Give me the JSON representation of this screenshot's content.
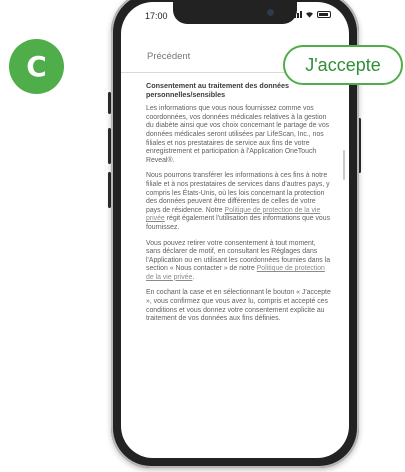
{
  "badge": {
    "letter": "C",
    "color": "#4fae4a"
  },
  "status": {
    "time": "17:00"
  },
  "nav": {
    "back_label": "Précédent",
    "accept_label": "J'accepte"
  },
  "content": {
    "title": "Consentement au traitement des données personnelles/sensibles",
    "p1": "Les informations que vous nous fournissez comme vos coordonnées, vos données médicales relatives à la gestion du diabète ainsi que vos choix concernant le partage de vos données médicales seront utilisées par LifeScan, Inc., nos filiales et nos prestataires de service aux fins de votre enregistrement et participation à l'Application OneTouch Reveal®.",
    "p2_before": "Nous pourrons transférer les informations à ces fins à notre filiale et à nos prestataires de services dans d'autres pays, y compris les États-Unis, où les lois concernant la protection des données peuvent être différentes de celles de votre pays de résidence. Notre ",
    "p2_link": "Politique de protection de la vie privée",
    "p2_after": " régit également l'utilisation des informations que vous fournissez.",
    "p3_before": "Vous pouvez retirer votre consentement à tout moment, sans déclarer de motif, en consultant les Réglages dans l'Application ou en utilisant les coordonnées fournies dans la section « Nous contacter » de notre ",
    "p3_link": "Politique de protection de la vie privée",
    "p3_after": ".",
    "p4": "En cochant la case et en sélectionnant le bouton « J'accepte », vous confirmez que vous avez lu, compris et accepté ces conditions et vous donnez votre consentement explicite au traitement de vos données aux fins définies."
  }
}
